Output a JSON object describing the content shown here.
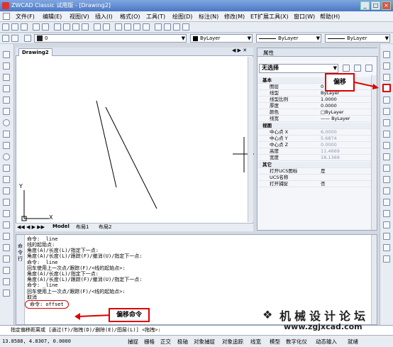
{
  "window": {
    "title": "ZWCAD Classic 试用版 - [Drawing2]"
  },
  "menu": {
    "items": [
      "文件(F)",
      "编辑(E)",
      "视图(V)",
      "插入(I)",
      "格式(O)",
      "工具(T)",
      "绘图(D)",
      "标注(N)",
      "修改(M)",
      "ET扩展工具(X)",
      "窗口(W)",
      "帮助(H)"
    ]
  },
  "toolbar": {
    "layer_value": "0",
    "color_value": "ByLayer",
    "linetype_value": "ByLayer",
    "lineweight_value": "ByLayer"
  },
  "drawing": {
    "tab_label": "Drawing2",
    "axis_y": "Y",
    "axis_x": "X",
    "layout_tabs": [
      "Model",
      "布局1",
      "布局2"
    ]
  },
  "properties": {
    "title": "属性",
    "selection": "无选择",
    "sections": {
      "basic": {
        "label": "基本",
        "rows": [
          [
            "图层",
            "0"
          ],
          [
            "线型",
            "ByLayer"
          ],
          [
            "线型比例",
            "1.0000"
          ],
          [
            "厚度",
            "0.0000"
          ],
          [
            "颜色",
            "□ByLayer"
          ],
          [
            "线宽",
            "—— ByLayer"
          ]
        ]
      },
      "view": {
        "label": "视图",
        "rows": [
          [
            "中心点 X",
            "6.0000"
          ],
          [
            "中心点 Y",
            "5.6874"
          ],
          [
            "中心点 Z",
            "0.0000"
          ],
          [
            "高度",
            "11.4669"
          ],
          [
            "宽度",
            "18.1369"
          ]
        ]
      },
      "other": {
        "label": "其它",
        "rows": [
          [
            "打开UCS图标",
            "是"
          ],
          [
            "UCS名称",
            ""
          ],
          [
            "打开捕捉",
            "否"
          ]
        ]
      }
    },
    "callout": "偏移"
  },
  "command": {
    "side_label": "命令行",
    "lines": [
      "命令: _line",
      "线的起始点:",
      "角度(A)/长度(L)/指定下一点:",
      "角度(A)/长度(L)/跟踪(F)/撤消(U)/指定下一点:",
      "命令: _line",
      "回车使用上一次点/跟踪(F)/<线的起始点>:",
      "角度(A)/长度(L)/指定下一点:",
      "角度(A)/长度(L)/跟踪(F)/撤消(U)/指定下一点:",
      "命令: _line",
      "回车使用上一次点/跟踪(F)/<线的起始点>:",
      "取消",
      "命令: offset",
      "指定偏移距离或 [通过(T)/拖拽(D)/删除(E)/图层(L)] <拖拽>:"
    ],
    "callout": "偏移命令"
  },
  "watermark": {
    "title": "机械设计论坛",
    "url": "www.zgjxcad.com"
  },
  "status": {
    "coords": "13.8588, 4.8307, 0.0000",
    "buttons": [
      "捕捉",
      "栅格",
      "正交",
      "极轴",
      "对象捕捉",
      "对象追踪",
      "线宽",
      "模型",
      "数字化仪",
      "动态输入",
      "就绪"
    ]
  },
  "colors": {
    "accent_red": "#dd0000",
    "title_blue": "#4a78c4"
  }
}
